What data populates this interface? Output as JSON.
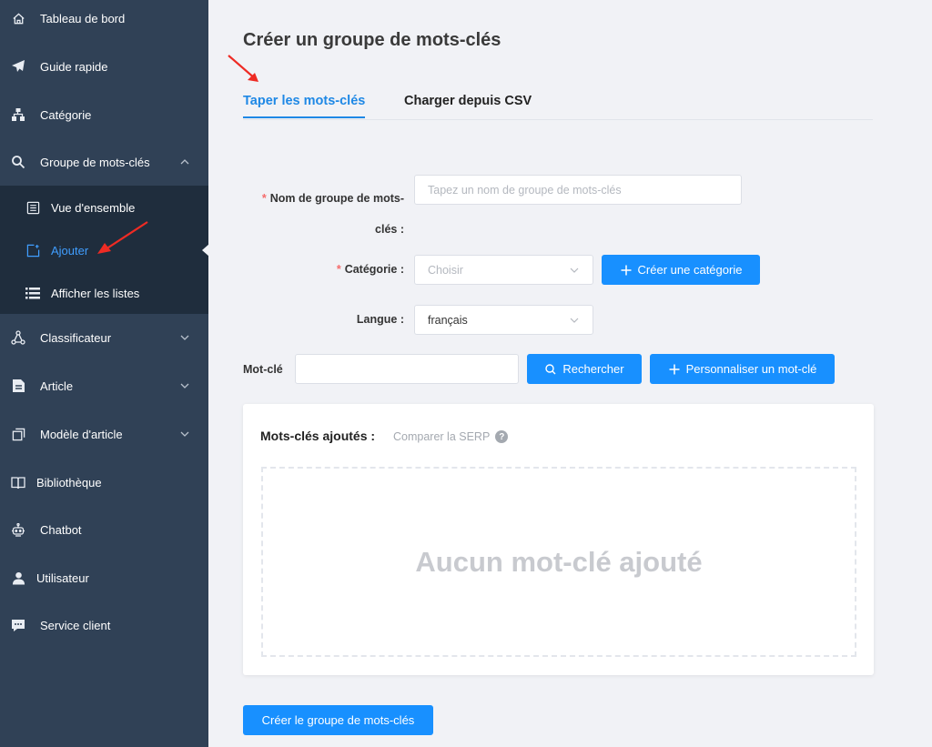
{
  "sidebar": {
    "items": [
      {
        "label": "Tableau de bord",
        "icon": "home-icon"
      },
      {
        "label": "Guide rapide",
        "icon": "paper-plane-icon"
      },
      {
        "label": "Catégorie",
        "icon": "sitemap-icon"
      },
      {
        "label": "Groupe de mots-clés",
        "icon": "search-key-icon",
        "expanded": true
      },
      {
        "label": "Classificateur",
        "icon": "network-icon"
      },
      {
        "label": "Article",
        "icon": "file-text-icon"
      },
      {
        "label": "Modèle d'article",
        "icon": "copy-icon"
      },
      {
        "label": "Bibliothèque",
        "icon": "book-icon"
      },
      {
        "label": "Chatbot",
        "icon": "robot-icon"
      },
      {
        "label": "Utilisateur",
        "icon": "user-icon"
      },
      {
        "label": "Service client",
        "icon": "chat-icon"
      }
    ],
    "submenu": [
      {
        "label": "Vue d'ensemble",
        "icon": "list-box-icon"
      },
      {
        "label": "Ajouter",
        "icon": "add-file-icon",
        "active": true
      },
      {
        "label": "Afficher les listes",
        "icon": "list-icon"
      }
    ]
  },
  "page": {
    "title": "Créer un groupe de mots-clés",
    "tabs": [
      {
        "label": "Taper les mots-clés",
        "active": true
      },
      {
        "label": "Charger depuis CSV",
        "active": false
      }
    ]
  },
  "form": {
    "required_mark": "*",
    "group_name": {
      "label_line1": "Nom de groupe de mots-",
      "label_line2": "clés :",
      "placeholder": "Tapez un nom de groupe de mots-clés",
      "value": ""
    },
    "category": {
      "label": "Catégorie :",
      "placeholder": "Choisir",
      "create_button": "Créer une catégorie"
    },
    "language": {
      "label": "Langue :",
      "value": "français"
    },
    "keyword": {
      "label": "Mot-clé",
      "value": "",
      "search_button": "Rechercher",
      "custom_button": "Personnaliser un mot-clé"
    }
  },
  "keywords_card": {
    "title": "Mots-clés ajoutés :",
    "compare_link": "Comparer la SERP",
    "help_glyph": "?",
    "empty_text": "Aucun mot-clé ajouté"
  },
  "submit_button": "Créer le groupe de mots-clés",
  "colors": {
    "sidebar_bg": "#304156",
    "submenu_bg": "#1f2d3d",
    "accent": "#1890ff",
    "annotation_arrow": "#ee2b24"
  }
}
